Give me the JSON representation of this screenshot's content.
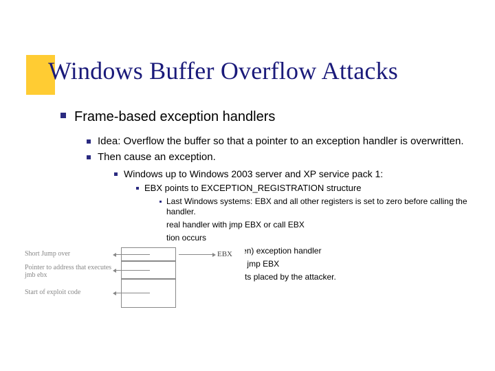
{
  "title": "Windows Buffer Overflow Attacks",
  "b1": "Frame-based exception handlers",
  "b2a": "Idea: Overflow the buffer so that a pointer to an exception handler is overwritten.",
  "b2b": "Then cause an exception.",
  "b3": "Windows up to Windows 2003 server and XP service pack 1:",
  "b4": "EBX points to EXCEPTION_REGISTRATION structure",
  "b5a": "Last Windows systems: EBX and all other registers is set to zero before calling the handler.",
  "b5b": "real handler with jmp EBX or call EBX",
  "b5c": "tion occurs",
  "b5d": "l passes to (overwritten) exception handler",
  "b5e": "tion handler executes jmp EBX",
  "b5f": "l ends up in statements placed by the attacker.",
  "diagram": {
    "label1": "Short Jump over",
    "label2": "Pointer to address that executes jmb ebx",
    "label3": "Start of exploit code",
    "ebx": "EBX"
  }
}
